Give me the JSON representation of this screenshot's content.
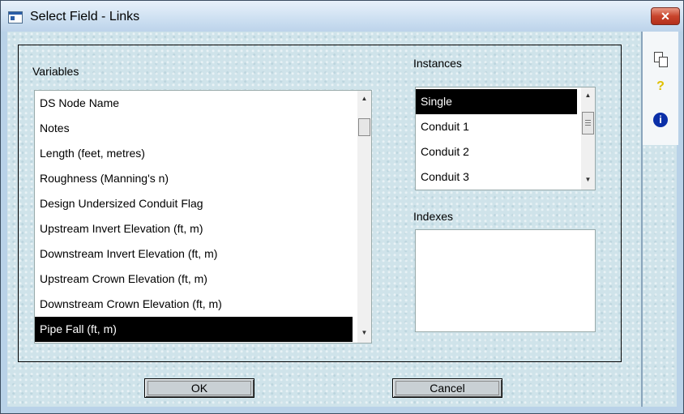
{
  "window": {
    "title": "Select Field - Links",
    "close_label": "✕"
  },
  "variables": {
    "label": "Variables",
    "items": [
      "DS Node Name",
      "Notes",
      "Length (feet, metres)",
      "Roughness (Manning's n)",
      "Design Undersized Conduit Flag",
      "Upstream Invert Elevation (ft, m)",
      "Downstream Invert Elevation (ft, m)",
      "Upstream Crown Elevation (ft, m)",
      "Downstream Crown Elevation (ft, m)",
      "Pipe Fall (ft, m)"
    ],
    "selected": "Pipe Fall (ft, m)"
  },
  "instances": {
    "label": "Instances",
    "items": [
      "Single",
      "Conduit 1",
      "Conduit 2",
      "Conduit 3"
    ],
    "selected": "Single"
  },
  "indexes": {
    "label": "Indexes",
    "items": []
  },
  "buttons": {
    "ok": "OK",
    "cancel": "Cancel"
  },
  "sidebar": {
    "icons": [
      "copy-icon",
      "help-icon",
      "info-icon"
    ],
    "help_glyph": "?",
    "info_glyph": "i"
  },
  "colors": {
    "selection": "#000000",
    "close_button": "#c8442c",
    "background": "#cfe3ea"
  }
}
